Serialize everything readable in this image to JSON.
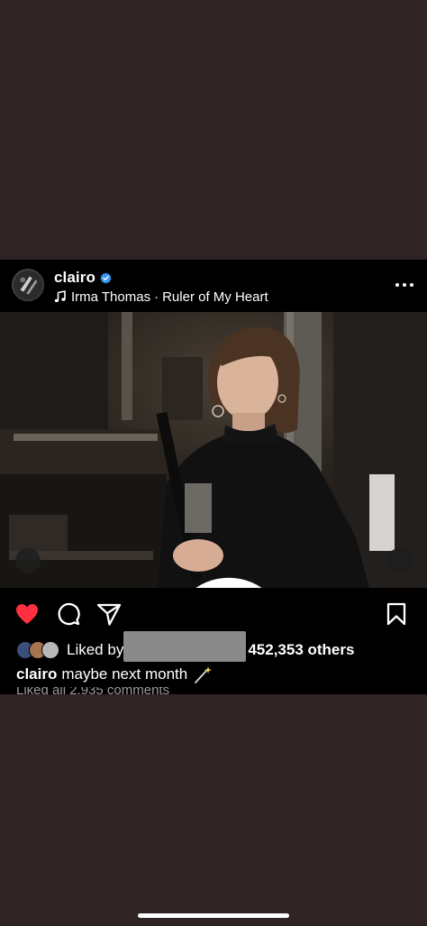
{
  "post": {
    "username": "clairo",
    "verified": true,
    "music": {
      "artist": "Irma Thomas",
      "separator": "·",
      "song": "Ruler of My Heart"
    },
    "likes": {
      "prefix": "Liked by",
      "count_text": "452,353 others"
    },
    "caption": {
      "username": "clairo",
      "text": "maybe next month"
    },
    "truncated_line": "Liked all 2,935 comments"
  },
  "icons": {
    "more": "more-horizontal-icon",
    "like": "heart-filled-icon",
    "comment": "comment-icon",
    "share": "send-icon",
    "save": "bookmark-icon",
    "tag": "person-tag-icon",
    "sound": "speaker-icon",
    "verified": "verified-badge-icon",
    "music": "music-note-icon",
    "caption_emoji": "magic-wand-icon"
  },
  "colors": {
    "page_background": "#2f2323",
    "post_background": "#000000",
    "like_red": "#ff3040",
    "verified_blue": "#3897f0",
    "redaction_gray": "#8a8a8a"
  }
}
